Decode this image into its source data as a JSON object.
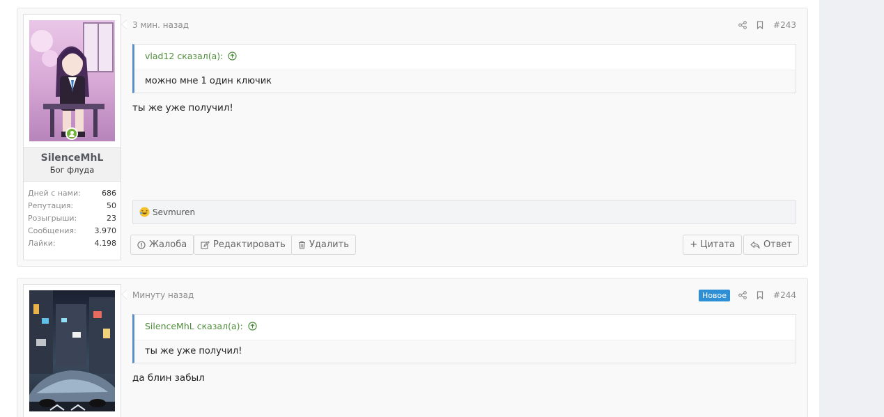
{
  "posts": [
    {
      "time": "3 мин. назад",
      "number": "#243",
      "badge": "",
      "user": {
        "name": "SilenceMhL",
        "title": "Бог флуда",
        "stats": [
          {
            "label": "Дней с нами:",
            "value": "686"
          },
          {
            "label": "Репутация:",
            "value": "50"
          },
          {
            "label": "Розыгрыши:",
            "value": "23"
          },
          {
            "label": "Сообщения:",
            "value": "3.970"
          },
          {
            "label": "Лайки:",
            "value": "4.198"
          }
        ]
      },
      "quote": {
        "author": "vlad12 сказал(а):",
        "text": "можно мне 1 один ключик"
      },
      "text": "ты же уже получил!",
      "reaction_user": "Sevmuren",
      "actions": {
        "report": "Жалоба",
        "edit": "Редактировать",
        "delete": "Удалить",
        "quote": "+ Цитата",
        "reply": "Ответ"
      }
    },
    {
      "time": "Минуту назад",
      "number": "#244",
      "badge": "Новое",
      "quote": {
        "author": "SilenceMhL сказал(а):",
        "text": "ты же уже получил!"
      },
      "text": "да блин забыл"
    }
  ],
  "icons": {
    "share": "share-icon",
    "bookmark": "bookmark-icon",
    "online": "online-user-icon",
    "quote_arrow": "arrow-up-circle-icon",
    "reaction": "laughing-emoji-icon",
    "report": "exclamation-circle-icon",
    "edit": "edit-icon",
    "delete": "trash-icon",
    "reply": "reply-icon"
  },
  "colors": {
    "accent": "#2f8fd4",
    "quote_author": "#4f8d3c",
    "online": "#74b33a"
  }
}
